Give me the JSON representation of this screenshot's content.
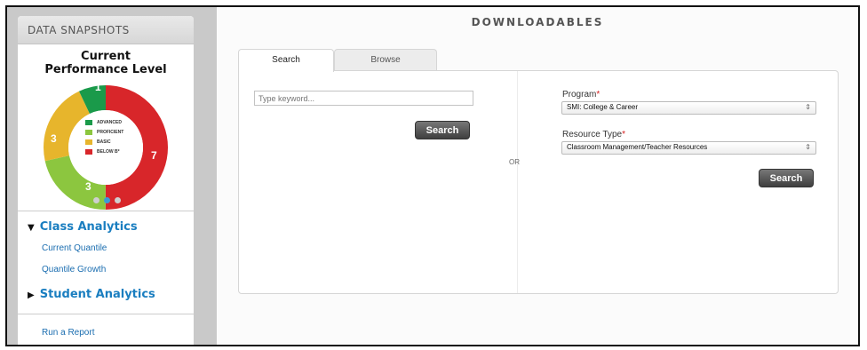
{
  "snapshots": {
    "header": "DATA SNAPSHOTS",
    "title_line1": "Current",
    "title_line2": "Performance Level",
    "legend": [
      {
        "label": "ADVANCED",
        "color": "#1a9a4a"
      },
      {
        "label": "PROFICIENT",
        "color": "#8cc63f"
      },
      {
        "label": "BASIC",
        "color": "#e7b52c"
      },
      {
        "label": "BELOW B*",
        "color": "#d8262a"
      }
    ],
    "segments": {
      "advanced": "1",
      "proficient": "3",
      "basic": "3",
      "below": "7"
    },
    "carousel": {
      "count": 3,
      "active": 2
    }
  },
  "nav": {
    "class_analytics": "Class Analytics",
    "class_items": [
      "Current Quantile",
      "Quantile Growth"
    ],
    "student_analytics": "Student Analytics",
    "run_report": "Run a Report"
  },
  "main": {
    "title": "DOWNLOADABLES",
    "tabs": {
      "search": "Search",
      "browse": "Browse"
    },
    "keyword_placeholder": "Type keyword...",
    "search_button": "Search",
    "or_text": "OR",
    "program_label": "Program",
    "program_value": "SMI: College & Career",
    "resource_label": "Resource Type",
    "resource_value": "Classroom Management/Teacher Resources",
    "required_mark": "*",
    "select_arrow": "⇕",
    "search_button_2": "Search"
  }
}
